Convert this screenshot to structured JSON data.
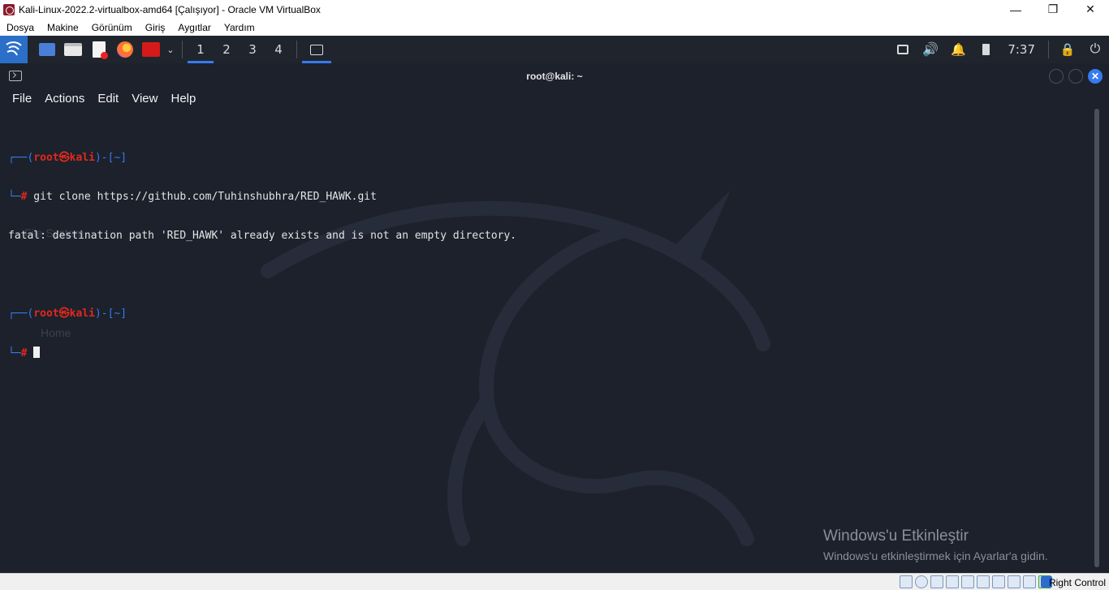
{
  "window": {
    "title": "Kali-Linux-2022.2-virtualbox-amd64 [Çalışıyor] - Oracle VM VirtualBox",
    "minimize": "—",
    "restore": "❐",
    "close": "✕"
  },
  "vbox_menu": [
    "Dosya",
    "Makine",
    "Görünüm",
    "Giriş",
    "Aygıtlar",
    "Yardım"
  ],
  "panel": {
    "workspaces": [
      "1",
      "2",
      "3",
      "4"
    ],
    "active_workspace": "1",
    "clock": "7:37"
  },
  "terminal": {
    "title": "root@kali: ~",
    "menu": [
      "File",
      "Actions",
      "Edit",
      "View",
      "Help"
    ],
    "lines": [
      {
        "prefix": "┌──(",
        "user": "root㉿kali",
        "suffix": ")-[~]"
      },
      {
        "prefix": "└─",
        "hash": "#",
        "command": " git clone https://github.com/Tuhinshubhra/RED_HAWK.git"
      },
      {
        "output": "fatal: destination path 'RED_HAWK' already exists and is not an empty directory."
      },
      {
        "blank": ""
      },
      {
        "prefix": "┌──(",
        "user": "root㉿kali",
        "suffix": ")-[~]"
      },
      {
        "prefix": "└─",
        "hash": "#",
        "command": " "
      }
    ]
  },
  "activation": {
    "title": "Windows'u Etkinleştir",
    "subtitle": "Windows'u etkinleştirmek için Ayarlar'a gidin."
  },
  "status_bar": {
    "host_key": "Right Control"
  },
  "colors": {
    "accent": "#367bf0",
    "prompt_red": "#e2281e",
    "terminal_bg": "#1c212b"
  }
}
